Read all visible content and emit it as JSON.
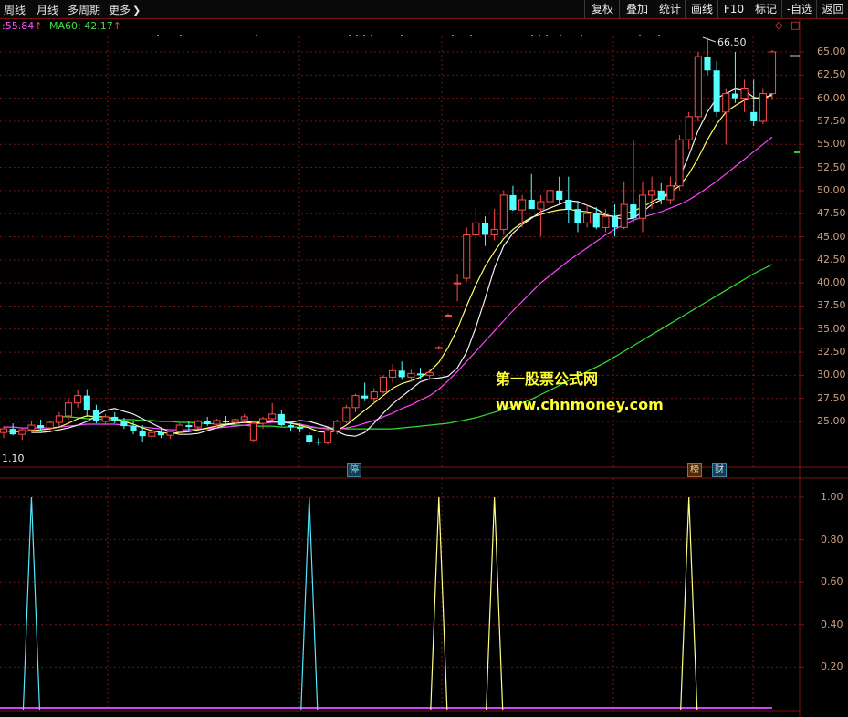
{
  "toolbar": {
    "tabs": [
      "周线",
      "月线",
      "多周期",
      "更多"
    ],
    "buttons": [
      "复权",
      "叠加",
      "统计",
      "画线",
      "F10",
      "标记",
      "-自选",
      "返回"
    ]
  },
  "indicators": {
    "ma_partial": ":55.84",
    "ma60_label": "MA60: 42.17"
  },
  "price_axis": {
    "labels": [
      "65.00",
      "62.50",
      "60.00",
      "57.50",
      "55.00",
      "52.50",
      "50.00",
      "47.50",
      "45.00",
      "42.50",
      "40.00",
      "37.50",
      "35.00",
      "32.50",
      "30.00",
      "27.50",
      "25.00"
    ]
  },
  "sub_axis": {
    "labels": [
      "1.00",
      "0.80",
      "0.60",
      "0.40",
      "0.20"
    ]
  },
  "annotations": {
    "high_price": "66.50",
    "left_value": "1.10",
    "limit_badge": "停",
    "list_badge": "榜",
    "finance_badge": "财",
    "corner_diamond": "◇",
    "corner_box": "□"
  },
  "watermark": {
    "line1": "第一股票公式网",
    "line2": "www.chnmoney.com"
  },
  "colors": {
    "up": "#ff4a4a",
    "down": "#54ffff",
    "ma_white": "#f0f0f0",
    "ma_yellow": "#ffff66",
    "ma_magenta": "#ff44ff",
    "ma_green": "#33dd33",
    "grid": "#7a1414",
    "axis_text": "#d0a080"
  },
  "chart_data": {
    "type": "candlestick",
    "price_ylim": [
      22.5,
      67.5
    ],
    "candles": [
      [
        23.8,
        24.5,
        23.2,
        24.2
      ],
      [
        24.2,
        24.8,
        23.5,
        23.6
      ],
      [
        23.6,
        24.3,
        23.0,
        24.1
      ],
      [
        24.1,
        25.0,
        23.8,
        24.6
      ],
      [
        24.6,
        25.2,
        24.0,
        24.3
      ],
      [
        24.3,
        25.0,
        24.0,
        24.9
      ],
      [
        24.9,
        26.0,
        24.5,
        25.6
      ],
      [
        25.6,
        27.5,
        25.2,
        27.0
      ],
      [
        27.0,
        28.4,
        26.5,
        27.8
      ],
      [
        27.8,
        28.5,
        25.5,
        26.2
      ],
      [
        26.2,
        26.8,
        24.8,
        25.0
      ],
      [
        25.0,
        25.8,
        24.6,
        25.5
      ],
      [
        25.5,
        26.0,
        24.8,
        25.0
      ],
      [
        25.0,
        25.4,
        24.2,
        24.5
      ],
      [
        24.5,
        25.0,
        23.6,
        24.0
      ],
      [
        24.0,
        24.6,
        22.8,
        23.4
      ],
      [
        23.4,
        24.0,
        23.0,
        23.8
      ],
      [
        23.8,
        24.2,
        23.2,
        23.5
      ],
      [
        23.5,
        24.0,
        23.1,
        23.9
      ],
      [
        23.9,
        24.8,
        23.6,
        24.6
      ],
      [
        24.6,
        25.0,
        24.0,
        24.4
      ],
      [
        24.4,
        25.2,
        24.2,
        25.0
      ],
      [
        25.0,
        25.5,
        24.5,
        24.7
      ],
      [
        24.7,
        25.3,
        24.3,
        25.1
      ],
      [
        25.1,
        25.6,
        24.8,
        24.9
      ],
      [
        24.9,
        25.3,
        24.5,
        25.2
      ],
      [
        25.2,
        25.8,
        24.9,
        25.5
      ],
      [
        23.0,
        25.0,
        22.8,
        24.8
      ],
      [
        24.8,
        25.5,
        24.2,
        25.3
      ],
      [
        25.3,
        27.0,
        25.0,
        25.8
      ],
      [
        25.8,
        26.2,
        24.5,
        24.6
      ],
      [
        24.6,
        25.0,
        24.0,
        24.4
      ],
      [
        24.4,
        24.8,
        23.8,
        24.2
      ],
      [
        23.5,
        23.8,
        22.5,
        22.8
      ],
      [
        22.8,
        23.2,
        22.4,
        22.7
      ],
      [
        22.7,
        24.2,
        22.5,
        24.0
      ],
      [
        24.0,
        25.2,
        23.6,
        25.0
      ],
      [
        25.0,
        26.8,
        24.8,
        26.5
      ],
      [
        26.5,
        28.0,
        26.0,
        27.8
      ],
      [
        27.8,
        29.2,
        27.2,
        27.5
      ],
      [
        27.5,
        28.6,
        27.0,
        28.2
      ],
      [
        28.2,
        30.0,
        28.0,
        29.8
      ],
      [
        29.8,
        31.2,
        29.2,
        30.5
      ],
      [
        30.5,
        31.5,
        29.5,
        29.8
      ],
      [
        29.8,
        30.6,
        29.3,
        30.2
      ],
      [
        30.2,
        30.8,
        29.6,
        30.0
      ],
      [
        30.0,
        30.6,
        29.5,
        30.3
      ],
      [
        33.0,
        33.2,
        32.8,
        33.0
      ],
      [
        36.5,
        36.7,
        36.3,
        36.5
      ],
      [
        40.0,
        41.0,
        38.0,
        40.0
      ],
      [
        40.5,
        46.0,
        40.2,
        45.2
      ],
      [
        45.2,
        48.2,
        44.8,
        46.5
      ],
      [
        46.5,
        47.2,
        44.0,
        45.2
      ],
      [
        45.2,
        48.0,
        44.6,
        45.8
      ],
      [
        45.8,
        50.0,
        45.2,
        49.5
      ],
      [
        49.5,
        50.5,
        47.8,
        47.9
      ],
      [
        47.9,
        49.5,
        46.0,
        49.0
      ],
      [
        49.0,
        51.8,
        48.5,
        48.0
      ],
      [
        48.0,
        49.5,
        45.0,
        48.8
      ],
      [
        48.8,
        50.0,
        48.0,
        50.0
      ],
      [
        50.0,
        51.5,
        48.5,
        49.0
      ],
      [
        49.0,
        51.5,
        46.5,
        48.0
      ],
      [
        48.0,
        48.8,
        45.5,
        46.5
      ],
      [
        46.5,
        48.5,
        46.0,
        47.5
      ],
      [
        47.5,
        48.2,
        45.8,
        46.0
      ],
      [
        46.0,
        48.0,
        45.5,
        47.2
      ],
      [
        47.2,
        48.5,
        45.0,
        46.0
      ],
      [
        46.0,
        51.0,
        45.8,
        48.5
      ],
      [
        48.5,
        55.5,
        46.5,
        47.0
      ],
      [
        47.0,
        51.0,
        45.5,
        49.5
      ],
      [
        49.5,
        51.5,
        48.0,
        50.0
      ],
      [
        50.0,
        50.8,
        48.5,
        49.0
      ],
      [
        49.0,
        51.5,
        48.5,
        50.5
      ],
      [
        50.5,
        56.0,
        50.0,
        55.5
      ],
      [
        55.5,
        58.5,
        54.5,
        58.0
      ],
      [
        58.0,
        65.0,
        57.5,
        64.5
      ],
      [
        64.5,
        66.5,
        62.5,
        63.0
      ],
      [
        63.0,
        64.0,
        58.0,
        58.5
      ],
      [
        58.5,
        61.0,
        55.0,
        60.5
      ],
      [
        60.5,
        65.0,
        59.5,
        60.0
      ],
      [
        60.0,
        62.0,
        58.5,
        61.0
      ],
      [
        58.5,
        62.0,
        57.0,
        57.5
      ],
      [
        57.5,
        61.0,
        57.2,
        60.5
      ],
      [
        60.5,
        65.2,
        59.8,
        65.0
      ]
    ],
    "moving_averages": [
      {
        "name": "",
        "values": [
          25.5,
          25.5,
          25.4,
          25.3,
          25.3,
          25.2,
          25.2,
          25.2,
          25.2,
          25.1,
          25.1,
          25.0,
          25.0,
          24.9,
          24.9,
          24.8,
          24.8,
          24.7,
          24.7,
          24.6,
          24.6,
          24.5,
          24.5,
          24.5,
          24.4,
          24.4,
          24.4,
          24.4,
          24.3,
          24.3,
          24.3,
          24.2,
          24.2,
          24.2,
          24.2,
          24.2,
          24.2,
          24.3,
          24.4,
          24.5,
          24.6,
          24.7,
          24.8,
          25.0,
          25.2,
          25.4,
          25.7,
          26.0,
          26.3,
          26.6,
          27.0,
          27.4,
          27.9,
          28.4,
          28.9,
          29.4,
          29.9,
          30.4,
          30.9,
          31.4,
          32.0,
          32.6,
          33.2,
          33.8,
          34.4,
          35.0,
          35.6,
          36.2,
          36.8,
          37.4,
          38.0,
          38.6,
          39.2,
          39.8,
          40.4,
          41.0,
          41.5,
          42.0
        ]
      },
      {
        "name": "",
        "values": [
          24.4,
          24.4,
          24.3,
          24.3,
          24.3,
          24.3,
          24.4,
          24.5,
          24.6,
          24.7,
          24.7,
          24.7,
          24.7,
          24.6,
          24.5,
          24.4,
          24.3,
          24.2,
          24.1,
          24.1,
          24.1,
          24.2,
          24.2,
          24.3,
          24.4,
          24.5,
          24.6,
          24.7,
          24.8,
          24.9,
          24.9,
          24.8,
          24.7,
          24.5,
          24.3,
          24.2,
          24.2,
          24.3,
          24.5,
          24.8,
          25.1,
          25.5,
          25.9,
          26.4,
          26.8,
          27.3,
          27.8,
          28.5,
          29.4,
          30.4,
          31.5,
          32.6,
          33.7,
          34.8,
          35.9,
          37.0,
          38.0,
          39.0,
          40.0,
          40.8,
          41.6,
          42.4,
          43.1,
          43.8,
          44.5,
          45.2,
          45.8,
          46.3,
          46.8,
          47.1,
          47.4,
          47.7,
          48.1,
          48.5,
          49.0,
          49.6,
          50.3,
          51.0,
          51.8,
          52.6,
          53.4,
          54.2,
          55.0,
          55.8
        ]
      },
      {
        "name": "",
        "values": [
          24.0,
          23.9,
          23.9,
          24.0,
          24.1,
          24.2,
          24.4,
          24.8,
          25.3,
          25.6,
          25.5,
          25.5,
          25.3,
          25.0,
          24.7,
          24.3,
          24.0,
          23.8,
          23.7,
          23.8,
          23.9,
          24.1,
          24.3,
          24.5,
          24.7,
          24.8,
          24.9,
          24.8,
          24.9,
          25.0,
          25.0,
          24.8,
          24.6,
          24.3,
          23.9,
          23.8,
          24.0,
          24.6,
          25.4,
          26.2,
          27.0,
          27.8,
          28.6,
          29.1,
          29.4,
          29.8,
          30.4,
          31.4,
          33.0,
          35.0,
          37.5,
          39.8,
          41.8,
          43.4,
          44.8,
          45.8,
          46.5,
          47.1,
          47.4,
          47.7,
          47.9,
          48.0,
          47.8,
          47.7,
          47.5,
          47.3,
          47.2,
          47.4,
          47.8,
          48.2,
          48.8,
          49.3,
          49.8,
          50.5,
          51.8,
          53.5,
          55.5,
          57.2,
          58.5,
          59.2,
          59.8,
          60.0,
          60.1,
          60.3
        ]
      },
      {
        "name": "",
        "values": [
          23.8,
          23.8,
          23.9,
          24.1,
          24.3,
          24.6,
          25.0,
          25.6,
          26.2,
          26.4,
          26.1,
          25.8,
          25.3,
          24.8,
          24.3,
          23.8,
          23.6,
          23.6,
          23.7,
          24.0,
          24.3,
          24.6,
          24.8,
          24.9,
          25.0,
          25.0,
          25.1,
          24.9,
          24.9,
          25.1,
          25.0,
          24.7,
          24.4,
          23.9,
          23.5,
          23.4,
          23.8,
          24.8,
          25.9,
          26.9,
          27.7,
          28.5,
          29.3,
          29.6,
          29.7,
          29.9,
          30.8,
          32.5,
          35.2,
          38.3,
          41.6,
          44.0,
          45.4,
          46.3,
          47.0,
          47.7,
          48.1,
          48.5,
          48.9,
          48.8,
          48.4,
          48.0,
          47.4,
          47.1,
          46.9,
          47.0,
          47.7,
          48.5,
          49.0,
          49.8,
          51.4,
          53.8,
          56.5,
          58.5,
          60.0,
          60.5,
          61.0,
          60.8,
          60.1,
          59.8,
          60.5
        ]
      }
    ],
    "subchart": {
      "ylim": [
        0,
        1.1
      ],
      "signals": [
        {
          "index": 3,
          "value": 1.0,
          "color": "cyan"
        },
        {
          "index": 33,
          "value": 1.0,
          "color": "cyan"
        },
        {
          "index": 47,
          "value": 1.0,
          "color": "yellow"
        },
        {
          "index": 53,
          "value": 1.0,
          "color": "yellow"
        },
        {
          "index": 74,
          "value": 1.0,
          "color": "yellow"
        }
      ]
    }
  }
}
